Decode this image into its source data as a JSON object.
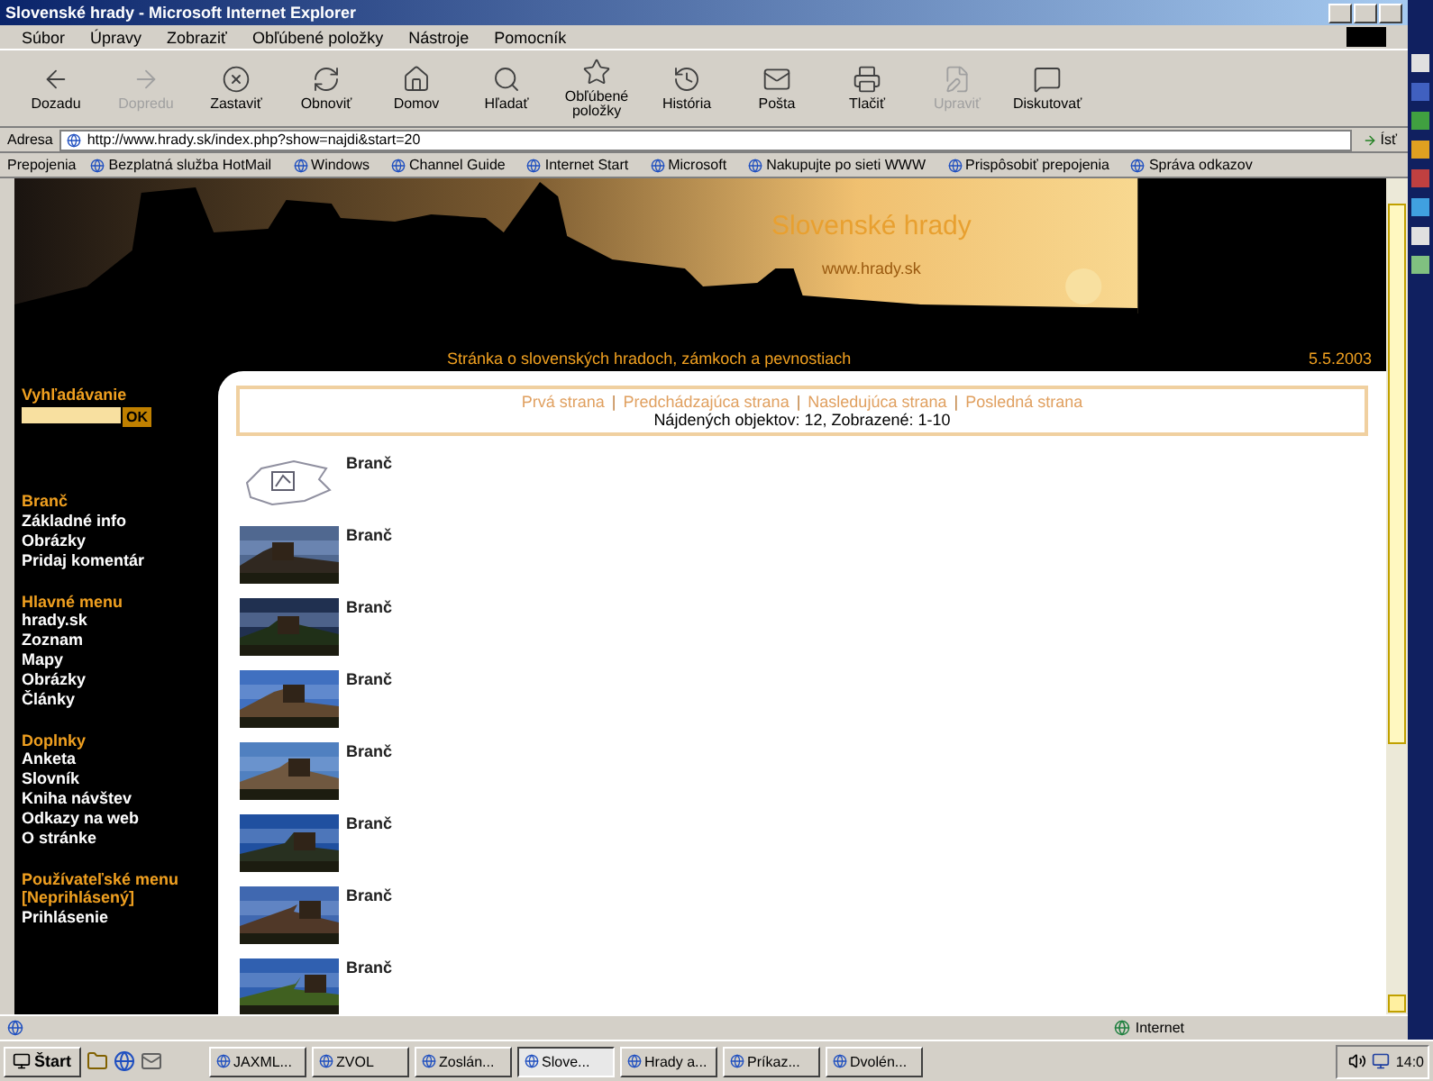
{
  "window": {
    "title": "Slovenské hrady - Microsoft Internet Explorer"
  },
  "menu": [
    "Súbor",
    "Úpravy",
    "Zobraziť",
    "Obľúbené položky",
    "Nástroje",
    "Pomocník"
  ],
  "toolbar": [
    {
      "kind": "back",
      "label": "Dozadu",
      "disabled": false
    },
    {
      "kind": "forward",
      "label": "Dopredu",
      "disabled": true
    },
    {
      "kind": "stop",
      "label": "Zastaviť",
      "disabled": false
    },
    {
      "kind": "refresh",
      "label": "Obnoviť",
      "disabled": false
    },
    {
      "kind": "home",
      "label": "Domov",
      "disabled": false
    },
    {
      "kind": "search",
      "label": "Hľadať",
      "disabled": false
    },
    {
      "kind": "favorites",
      "label": "Obľúbené položky",
      "disabled": false
    },
    {
      "kind": "history",
      "label": "História",
      "disabled": false
    },
    {
      "kind": "mail",
      "label": "Pošta",
      "disabled": false
    },
    {
      "kind": "print",
      "label": "Tlačiť",
      "disabled": false
    },
    {
      "kind": "edit",
      "label": "Upraviť",
      "disabled": true
    },
    {
      "kind": "discuss",
      "label": "Diskutovať",
      "disabled": false
    }
  ],
  "address": {
    "label": "Adresa",
    "value": "http://www.hrady.sk/index.php?show=najdi&start=20",
    "go": "Ísť"
  },
  "links": {
    "label": "Prepojenia",
    "items": [
      "Bezplatná služba HotMail",
      "Windows",
      "Channel Guide",
      "Internet Start",
      "Microsoft",
      "Nakupujte po sieti WWW",
      "Prispôsobiť prepojenia",
      "Správa odkazov"
    ]
  },
  "header": {
    "title": "Slovenské hrady",
    "subtitle": "www.hrady.sk",
    "tagline": "Stránka o slovenských hradoch, zámkoch a pevnostiach",
    "date": "5.5.2003"
  },
  "search": {
    "label": "Vyhľadávanie",
    "button": "OK"
  },
  "sidebar": [
    {
      "items": [
        {
          "text": "Branč",
          "highlighted": true
        },
        {
          "text": "Základné info",
          "highlighted": false
        },
        {
          "text": "Obrázky",
          "highlighted": false
        },
        {
          "text": "Pridaj komentár",
          "highlighted": false
        }
      ]
    },
    {
      "title": "Hlavné menu",
      "items": [
        {
          "text": "hrady.sk",
          "highlighted": false
        },
        {
          "text": "Zoznam",
          "highlighted": false
        },
        {
          "text": "Mapy",
          "highlighted": false
        },
        {
          "text": "Obrázky",
          "highlighted": false
        },
        {
          "text": "Články",
          "highlighted": false
        }
      ]
    },
    {
      "title": "Doplnky",
      "items": [
        {
          "text": "Anketa",
          "highlighted": false
        },
        {
          "text": "Slovník",
          "highlighted": false
        },
        {
          "text": "Kniha návštev",
          "highlighted": false
        },
        {
          "text": "Odkazy na web",
          "highlighted": false
        },
        {
          "text": "O stránke",
          "highlighted": false
        }
      ]
    },
    {
      "title": "Používateľské menu",
      "items": [
        {
          "text": "[Neprihlásený]",
          "highlighted": true
        },
        {
          "text": "Prihlásenie",
          "highlighted": false
        }
      ]
    }
  ],
  "pager": {
    "separator": "|",
    "links": [
      "Prvá strana",
      "Predchádzajúca strana",
      "Nasledujúca strana",
      "Posledná strana"
    ],
    "summary": "Nájdených objektov: 12, Zobrazené: 1-10"
  },
  "results": [
    {
      "kind": "map",
      "title": "Branč"
    },
    {
      "kind": "picture",
      "title": "Branč"
    },
    {
      "kind": "picture",
      "title": "Branč"
    },
    {
      "kind": "picture",
      "title": "Branč"
    },
    {
      "kind": "picture",
      "title": "Branč"
    },
    {
      "kind": "picture",
      "title": "Branč"
    },
    {
      "kind": "picture",
      "title": "Branč"
    },
    {
      "kind": "picture",
      "title": "Branč"
    }
  ],
  "status_bar": {
    "zone": "Internet"
  },
  "taskbar": {
    "start": "Štart",
    "windows": [
      {
        "label": "JAXML...",
        "selected": false
      },
      {
        "label": "ZVOL",
        "selected": false
      },
      {
        "label": "Zoslán...",
        "selected": false
      },
      {
        "label": "Slove...",
        "selected": true
      },
      {
        "label": "Hrady a...",
        "selected": false
      },
      {
        "label": "Príkaz...",
        "selected": false
      },
      {
        "label": "Dvolén...",
        "selected": false
      }
    ],
    "clock": "14:0"
  }
}
